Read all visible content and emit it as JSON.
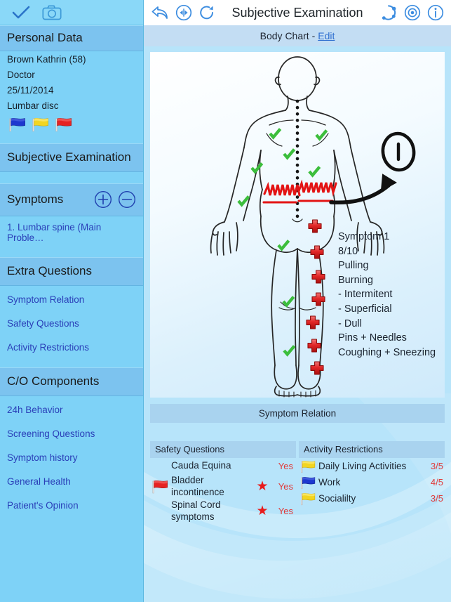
{
  "sidebar": {
    "toolbar": [
      {
        "name": "confirm-check-icon",
        "label": "check"
      },
      {
        "name": "camera-icon",
        "label": "camera"
      }
    ],
    "personal_data": {
      "header": "Personal Data",
      "patient_name": "Brown Kathrin (58)",
      "referrer": "Doctor",
      "date": "25/11/2014",
      "diagnosis": "Lumbar disc",
      "flags": [
        "#1d38cf",
        "#f2d521",
        "#e62222"
      ]
    },
    "subjective_examination": {
      "header": "Subjective Examination"
    },
    "symptoms": {
      "header": "Symptoms",
      "add_label": "+",
      "remove_label": "−",
      "items": [
        "1. Lumbar spine (Main Proble…"
      ]
    },
    "extra_questions": {
      "header": "Extra Questions",
      "items": [
        "Symptom Relation",
        "Safety Questions",
        "Activity Restrictions"
      ]
    },
    "co_components": {
      "header": "C/O Components",
      "items": [
        "24h Behavior",
        "Screening Questions",
        "Symptom history",
        "General Health",
        "Patient's Opinion"
      ]
    }
  },
  "main": {
    "toolbar": {
      "title": "Subjective Examination",
      "left_icons": [
        "undo-arrow-icon",
        "flip-horizontal-icon",
        "redo-arrow-icon"
      ],
      "right_icons": [
        "network-share-icon",
        "target-record-icon",
        "info-icon"
      ]
    },
    "subbar": {
      "label": "Body Chart -",
      "edit_label": "Edit"
    },
    "body_chart": {
      "annotation_marker": "1",
      "symptom_lines": [
        "Symptom 1",
        "8/10",
        "Pulling",
        "Burning",
        " - Intermitent",
        " - Superficial",
        " - Dull",
        "Pins + Needles",
        "Coughing + Sneezing"
      ]
    },
    "relation_bar": {
      "label": "Symptom Relation"
    },
    "safety_questions": {
      "header": "Safety Questions",
      "rows": [
        {
          "flag": "",
          "label": "Cauda Equina",
          "star": false,
          "value": "Yes"
        },
        {
          "flag": "#e62222",
          "label": "Bladder incontinence",
          "star": true,
          "value": "Yes"
        },
        {
          "flag": "",
          "label": "Spinal Cord symptoms",
          "star": true,
          "value": "Yes"
        }
      ]
    },
    "activity_restrictions": {
      "header": "Activity Restrictions",
      "rows": [
        {
          "flag": "#f2d521",
          "label": "Daily Living Activities",
          "value": "3/5"
        },
        {
          "flag": "#1d38cf",
          "label": "Work",
          "value": "4/5"
        },
        {
          "flag": "#f2d521",
          "label": "Socialilty",
          "value": "3/5"
        }
      ]
    }
  },
  "colors": {
    "sidebar_bg": "#7ed2f7",
    "sidebar_header_bg": "#7cc3ef",
    "main_bg": "#b7e4fa",
    "accent_link": "#2a3fb8",
    "value_red": "#e03a3a",
    "icon_blue": "#3d8de0"
  }
}
